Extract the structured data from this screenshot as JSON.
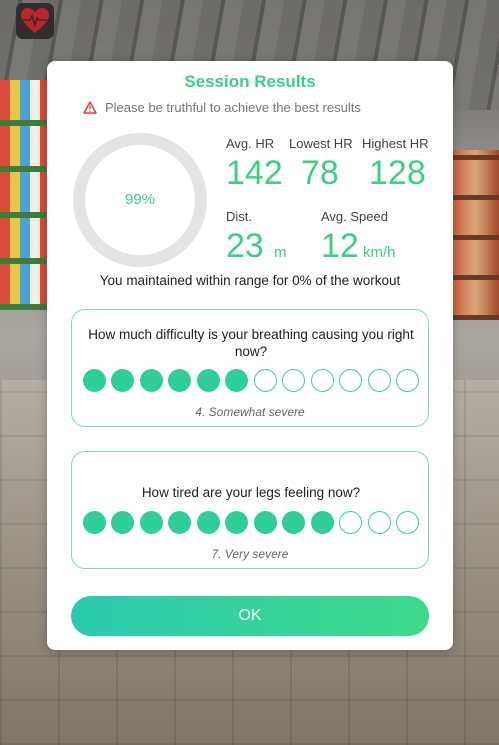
{
  "colors": {
    "accent": "#3ecf86",
    "dot_filled": "#2fcf9b",
    "card_border": "#7fdcb0",
    "warning_red": "#e0413a",
    "app_icon_heart": "#c0242b"
  },
  "app_icon": {
    "icon": "heart-monitor-icon"
  },
  "modal": {
    "title": "Session Results",
    "warning": {
      "icon": "warning-triangle-icon",
      "text": "Please be truthful to achieve the best results"
    },
    "progress": {
      "percent": 99,
      "label": "99%"
    },
    "stats": {
      "avg_hr": {
        "label": "Avg. HR",
        "value": "142"
      },
      "lowest_hr": {
        "label": "Lowest HR",
        "value": "78"
      },
      "highest_hr": {
        "label": "Highest HR",
        "value": "128"
      },
      "dist": {
        "label": "Dist.",
        "value": "23",
        "unit": "m"
      },
      "avg_speed": {
        "label": "Avg. Speed",
        "value": "12",
        "unit": "km/h"
      }
    },
    "range_text": "You maintained within range for 0% of the workout",
    "questions": [
      {
        "text": "How much difficulty is your breathing causing you right now?",
        "scale_count": 12,
        "selected_count": 6,
        "answer": "4. Somewhat severe"
      },
      {
        "text": "How tired are your legs feeling now?",
        "scale_count": 12,
        "selected_count": 9,
        "answer": "7. Very severe"
      }
    ],
    "ok_label": "OK"
  }
}
